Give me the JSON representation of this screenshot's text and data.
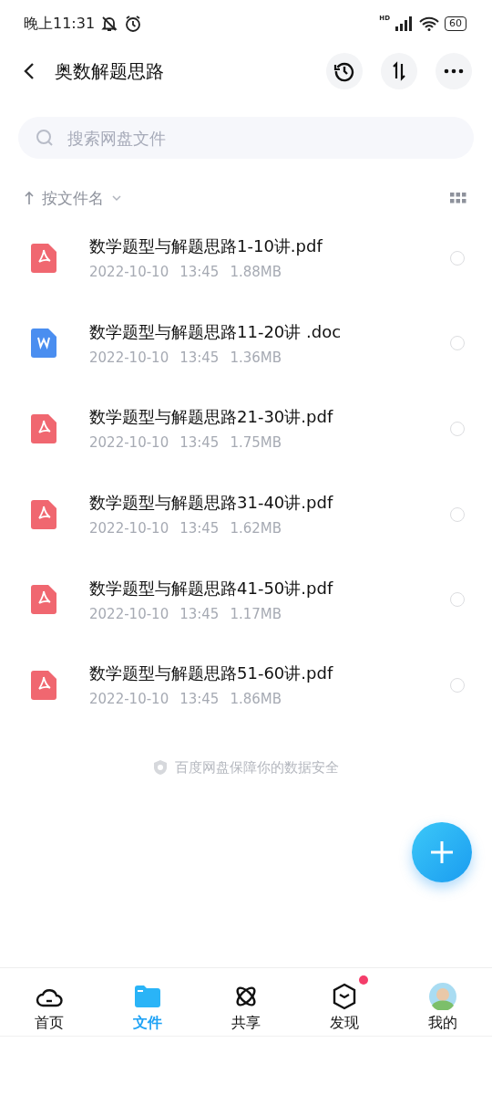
{
  "status_bar": {
    "time": "晚上11:31",
    "battery": "60",
    "network": "HD"
  },
  "header": {
    "title": "奥数解题思路"
  },
  "search": {
    "placeholder": "搜索网盘文件"
  },
  "sort": {
    "label": "按文件名"
  },
  "files": [
    {
      "kind": "pdf",
      "name": "数学题型与解题思路1-10讲.pdf",
      "date": "2022-10-10",
      "time": "13:45",
      "size": "1.88MB",
      "selected": false
    },
    {
      "kind": "doc",
      "name": "数学题型与解题思路11-20讲 .doc",
      "date": "2022-10-10",
      "time": "13:45",
      "size": "1.36MB",
      "selected": false
    },
    {
      "kind": "pdf",
      "name": "数学题型与解题思路21-30讲.pdf",
      "date": "2022-10-10",
      "time": "13:45",
      "size": "1.75MB",
      "selected": false
    },
    {
      "kind": "pdf",
      "name": "数学题型与解题思路31-40讲.pdf",
      "date": "2022-10-10",
      "time": "13:45",
      "size": "1.62MB",
      "selected": false
    },
    {
      "kind": "pdf",
      "name": "数学题型与解题思路41-50讲.pdf",
      "date": "2022-10-10",
      "time": "13:45",
      "size": "1.17MB",
      "selected": false
    },
    {
      "kind": "pdf",
      "name": "数学题型与解题思路51-60讲.pdf",
      "date": "2022-10-10",
      "time": "13:45",
      "size": "1.86MB",
      "selected": false
    }
  ],
  "footer_note": "百度网盘保障你的数据安全",
  "bottom_nav": [
    {
      "kind": "home",
      "label": "首页",
      "selected": false,
      "badge": false
    },
    {
      "kind": "files",
      "label": "文件",
      "selected": true,
      "badge": false
    },
    {
      "kind": "share",
      "label": "共享",
      "selected": false,
      "badge": false
    },
    {
      "kind": "discover",
      "label": "发现",
      "selected": false,
      "badge": true
    },
    {
      "kind": "me",
      "label": "我的",
      "selected": false,
      "badge": false
    }
  ]
}
